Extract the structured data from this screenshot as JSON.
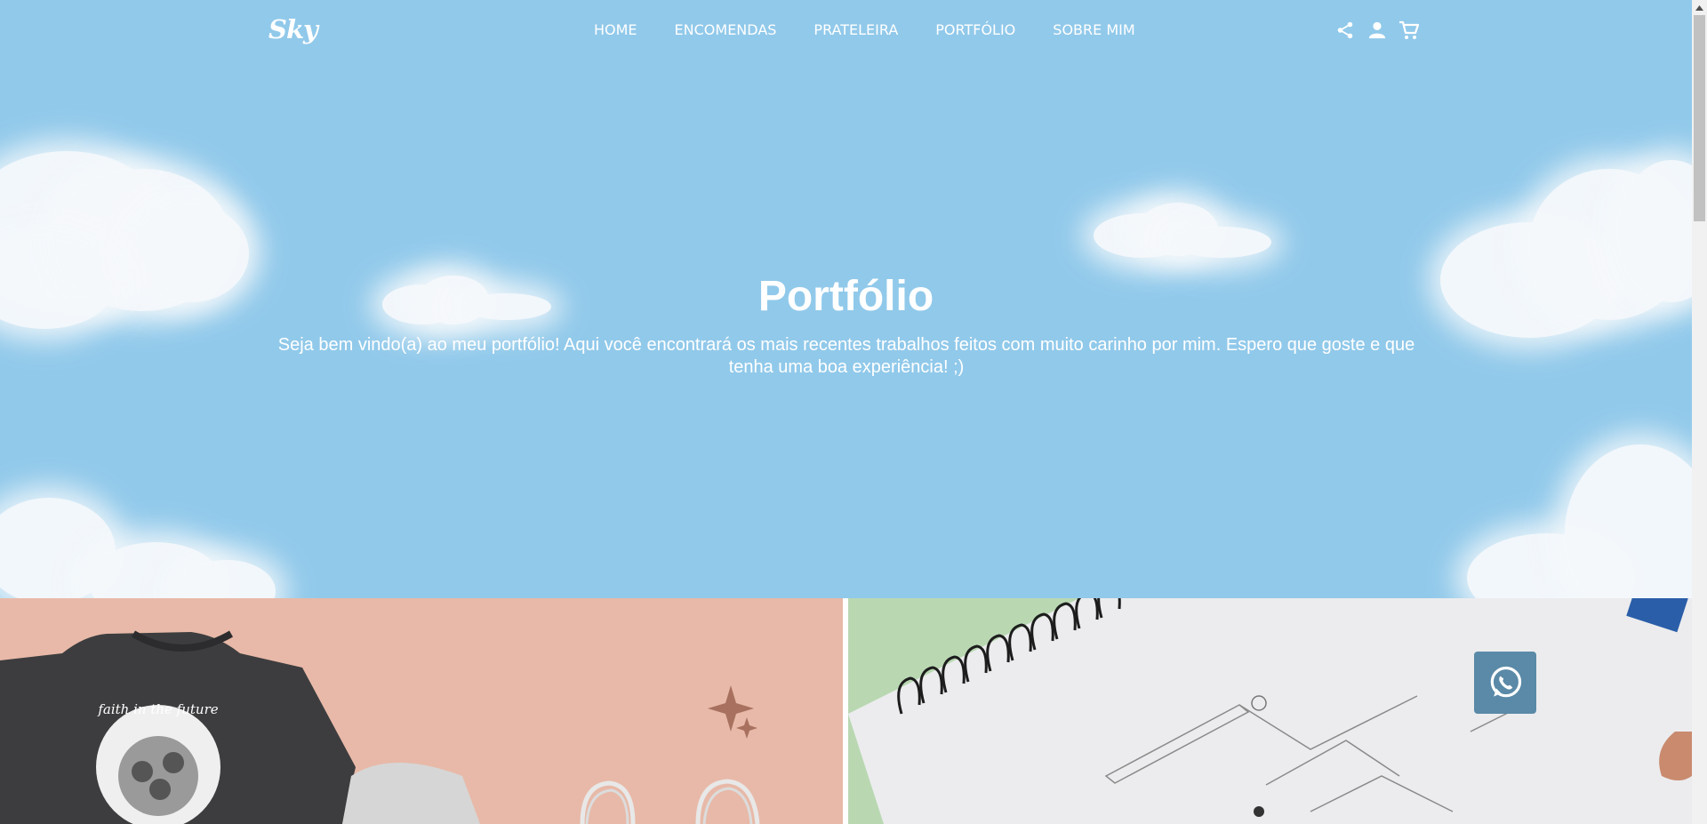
{
  "brand": {
    "logo_text": "Sky"
  },
  "nav": {
    "links": [
      {
        "label": "HOME"
      },
      {
        "label": "ENCOMENDAS"
      },
      {
        "label": "PRATELEIRA"
      },
      {
        "label": "PORTFÓLIO"
      },
      {
        "label": "SOBRE MIM"
      }
    ],
    "icons": [
      "share-icon",
      "user-icon",
      "cart-icon"
    ]
  },
  "hero": {
    "title": "Portfólio",
    "subtitle": "Seja bem vindo(a) ao meu portfólio! Aqui você encontrará os mais recentes trabalhos feitos com muito carinho por mim. Espero que goste e que tenha uma boa experiência! ;)"
  },
  "gallery": {
    "items": [
      {
        "name": "sweatshirt-photo",
        "shirt_print": "faith in the future"
      },
      {
        "name": "notebook-sketch-photo"
      }
    ]
  },
  "whatsapp": {
    "icon": "whatsapp-icon"
  },
  "colors": {
    "sky": "#91c9ea",
    "cloud": "#f6f9fc",
    "peach": "#e8b9a8",
    "mint": "#b9d8b2",
    "whatsapp_button": "#5a8aa7"
  }
}
